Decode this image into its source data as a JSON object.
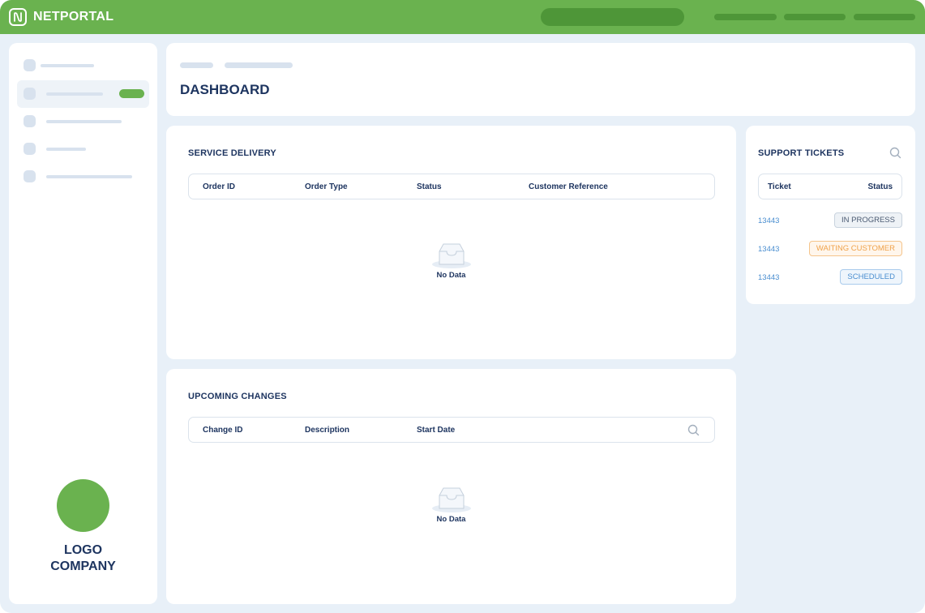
{
  "app": {
    "name": "NETPORTAL"
  },
  "logo": {
    "line1": "LOGO",
    "line2": "COMPANY"
  },
  "page": {
    "title": "DASHBOARD"
  },
  "service_delivery": {
    "title": "SERVICE DELIVERY",
    "columns": [
      "Order ID",
      "Order Type",
      "Status",
      "Customer Reference"
    ],
    "empty_text": "No Data"
  },
  "upcoming_changes": {
    "title": "UPCOMING CHANGES",
    "columns": [
      "Change ID",
      "Description",
      "Start Date"
    ],
    "empty_text": "No Data"
  },
  "support_tickets": {
    "title": "SUPPORT TICKETS",
    "columns": [
      "Ticket",
      "Status"
    ],
    "rows": [
      {
        "id": "13443",
        "status": "IN PROGRESS"
      },
      {
        "id": "13443",
        "status": "WAITING CUSTOMER"
      },
      {
        "id": "13443",
        "status": "SCHEDULED"
      }
    ]
  },
  "colors": {
    "brand_green": "#6ab24f",
    "navy": "#1e3560",
    "link_blue": "#4a8ed0",
    "in_progress": "#4a5a72",
    "waiting": "#f0a24a",
    "scheduled": "#4a8ed0"
  },
  "icons": [
    "netportal-logo-icon",
    "search-icon",
    "inbox-empty-icon"
  ]
}
